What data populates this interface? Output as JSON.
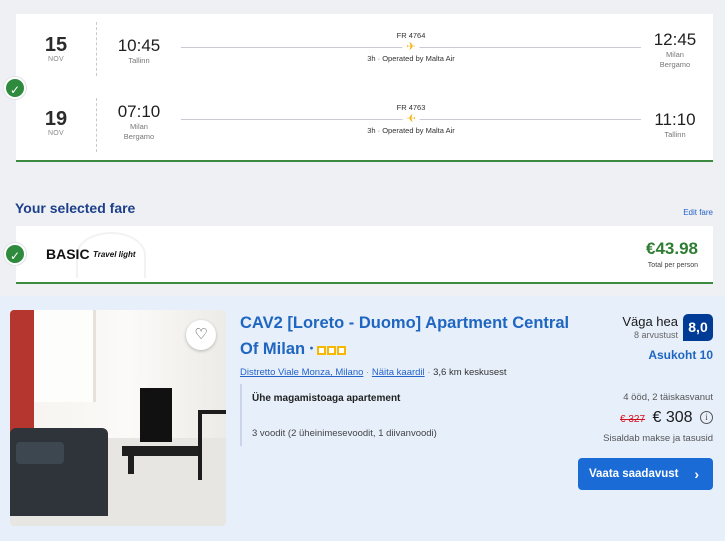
{
  "flights": [
    {
      "day": "15",
      "month": "NOV",
      "dep_time": "10:45",
      "dep_place": [
        "Tallinn"
      ],
      "flight_no": "FR 4764",
      "duration": "3h · Operated by Malta Air",
      "arr_time": "12:45",
      "arr_place": [
        "Milan",
        "Bergamo"
      ]
    },
    {
      "day": "19",
      "month": "NOV",
      "dep_time": "07:10",
      "dep_place": [
        "Milan",
        "Bergamo"
      ],
      "flight_no": "FR 4763",
      "duration": "3h · Operated by Malta Air",
      "arr_time": "11:10",
      "arr_place": [
        "Tallinn"
      ]
    }
  ],
  "fare": {
    "heading": "Your selected fare",
    "edit_link": "Edit fare",
    "name": "BASIC",
    "tag": "Travel light",
    "price": "€43.98",
    "price_note": "Total per person"
  },
  "hotel": {
    "name": "CAV2 [Loreto - Duomo] Apartment Central Of Milan",
    "stars": 3,
    "district_link": "Distretto Viale Monza, Milano",
    "map_link": "Näita kaardil",
    "distance": "3,6 km keskusest",
    "room_type": "Ühe magamistoaga apartement",
    "beds": "3 voodit (2 üheinimesevoodit, 1 diivanvoodi)",
    "score_label": "Väga hea",
    "reviews": "8 arvustust",
    "score": "8,0",
    "location_score": "Asukoht 10",
    "stay": "4 ööd, 2 täiskasvanut",
    "old_price": "€ 327",
    "price": "€ 308",
    "tax_note": "Sisaldab makse ja tasusid",
    "button": "Vaata saadavust"
  },
  "icons": {
    "check": "✓",
    "plane": "✈",
    "heart": "♡",
    "info": "i",
    "chevron": "›"
  },
  "colors": {
    "brand_blue": "#1d3f8a",
    "link_blue": "#1f66c1",
    "success_green": "#2e8b3e",
    "score_navy": "#003b95",
    "button_blue": "#1a6bd6",
    "strike_red": "#d4111e",
    "star_yellow": "#f6b800",
    "plane_yellow": "#f2b81b"
  }
}
